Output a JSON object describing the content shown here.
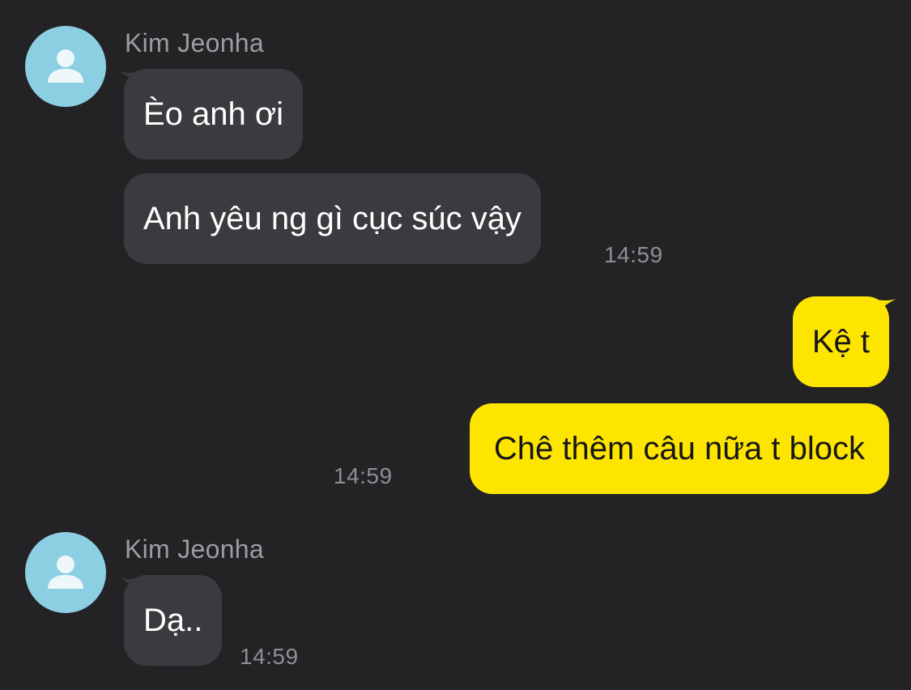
{
  "colors": {
    "background": "#232326",
    "incoming_bubble": "#3b3b3f",
    "outgoing_bubble": "#fee500",
    "avatar": "#8ccfe3",
    "sender_name": "#9c9ca1",
    "timestamp": "#8e8e93"
  },
  "groups": [
    {
      "direction": "incoming",
      "sender": "Kim Jeonha",
      "avatar_icon": "default-profile-icon",
      "messages": [
        "Èo anh ơi",
        "Anh yêu ng gì cục súc vậy"
      ],
      "time": "14:59"
    },
    {
      "direction": "outgoing",
      "messages": [
        "Kệ t",
        "Chê thêm câu nữa t block"
      ],
      "time": "14:59"
    },
    {
      "direction": "incoming",
      "sender": "Kim Jeonha",
      "avatar_icon": "default-profile-icon",
      "messages": [
        "Dạ.."
      ],
      "time": "14:59"
    }
  ]
}
